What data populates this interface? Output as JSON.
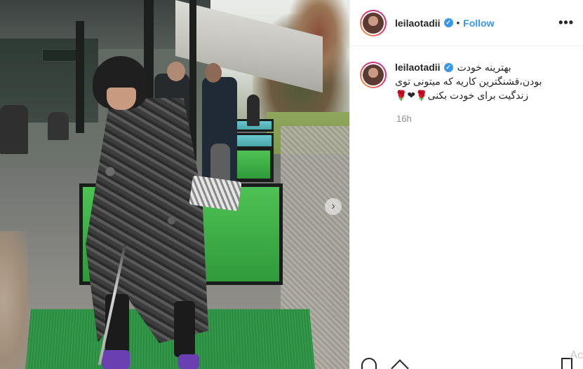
{
  "post": {
    "image_alt": "Woman in a patterned coat and black beanie swinging a golf club at a driving range",
    "next_arrow": "›"
  },
  "header": {
    "username": "leilaotadii",
    "verified_mark": "✓",
    "separator": "•",
    "follow_label": "Follow",
    "more_label": "•••"
  },
  "caption": {
    "username": "leilaotadii",
    "verified_mark": "✓",
    "line1": "بهترینه خودت",
    "line2": "بودن،قشنگترین کاریه که میتونی توی",
    "line3": "زندگیت برای خودت بکنی🌹❤🌹",
    "time": "16h"
  },
  "watermark": "Ac",
  "colors": {
    "accent": "#3897f0",
    "text": "#262626",
    "muted": "#8e8e8e"
  }
}
